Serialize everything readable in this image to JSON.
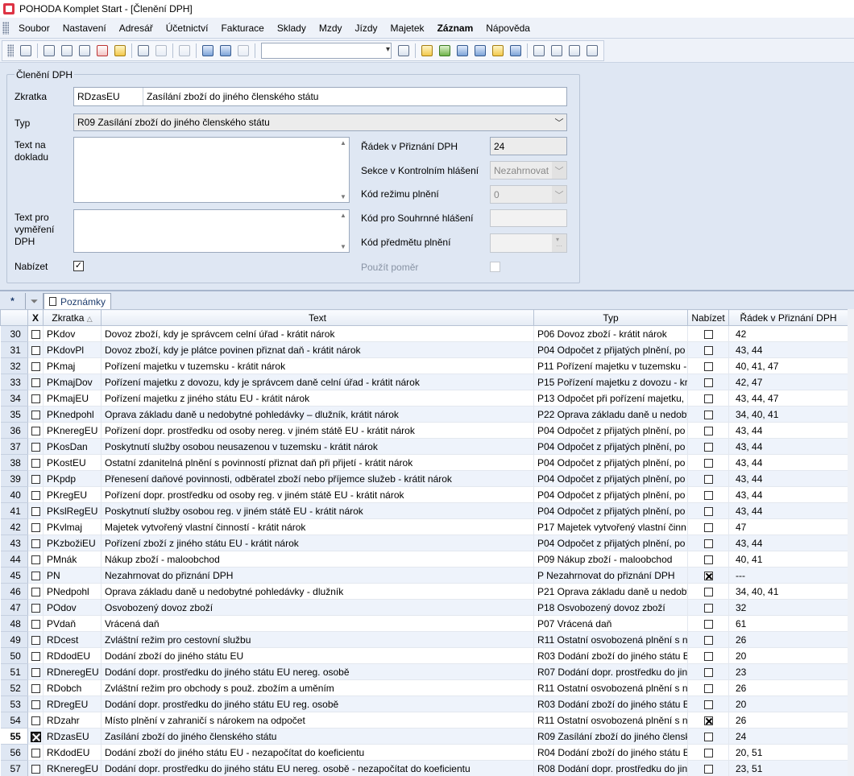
{
  "window": {
    "title": "POHODA Komplet Start - [Členění DPH]"
  },
  "menu": [
    "Soubor",
    "Nastavení",
    "Adresář",
    "Účetnictví",
    "Fakturace",
    "Sklady",
    "Mzdy",
    "Jízdy",
    "Majetek",
    "Záznam",
    "Nápověda"
  ],
  "form": {
    "legend": "Členění DPH",
    "zkratka_label": "Zkratka",
    "zkratka_value": "RDzasEU",
    "nazev_value": "Zasílání zboží do jiného členského státu",
    "typ_label": "Typ",
    "typ_value": "R09 Zasílání zboží do jiného členského státu",
    "text_na_dokladu_label": "Text na dokladu",
    "text_pro_vymereni_label": "Text pro vyměření DPH",
    "nabizet_label": "Nabízet",
    "nabizet_checked": "✓",
    "radek_label": "Řádek v Přiznání DPH",
    "radek_value": "24",
    "sekce_label": "Sekce v Kontrolním hlášení",
    "sekce_value": "Nezahrnovat",
    "kod_rezimu_label": "Kód režimu plnění",
    "kod_rezimu_value": "0",
    "kod_souhrnne_label": "Kód pro Souhrnné hlášení",
    "kod_predmetu_label": "Kód předmětu plnění",
    "pouzit_pomer_label": "Použít poměr"
  },
  "tabs": {
    "star": "*",
    "notes": "Poznámky"
  },
  "grid": {
    "columns": {
      "x": "X",
      "zkratka": "Zkratka",
      "text": "Text",
      "typ": "Typ",
      "nabizet": "Nabízet",
      "radek": "Řádek v Přiznání DPH"
    },
    "rows": [
      {
        "n": "30",
        "z": "PKdov",
        "t": "Dovoz zboží, kdy je správcem celní úřad - krátit nárok",
        "typ": "P06 Dovoz zboží - krátit nárok",
        "nab": false,
        "r": "42",
        "sel": false
      },
      {
        "n": "31",
        "z": "PKdovPl",
        "t": "Dovoz zboží, kdy je plátce povinen přiznat daň - krátit nárok",
        "typ": "P04 Odpočet z přijatých plnění, po",
        "nab": false,
        "r": "43, 44",
        "sel": false
      },
      {
        "n": "32",
        "z": "PKmaj",
        "t": "Pořízení majetku v tuzemsku - krátit nárok",
        "typ": "P11 Pořízení majetku v tuzemsku -",
        "nab": false,
        "r": "40, 41, 47",
        "sel": false
      },
      {
        "n": "33",
        "z": "PKmajDov",
        "t": "Pořízení majetku z dovozu, kdy je správcem daně celní úřad - krátit nárok",
        "typ": "P15 Pořízení majetku z dovozu - kr",
        "nab": false,
        "r": "42, 47",
        "sel": false
      },
      {
        "n": "34",
        "z": "PKmajEU",
        "t": "Pořízení majetku z jiného státu EU - krátit nárok",
        "typ": "P13 Odpočet při pořízení majetku,",
        "nab": false,
        "r": "43, 44, 47",
        "sel": false
      },
      {
        "n": "35",
        "z": "PKnedpohl",
        "t": "Oprava základu daně u nedobytné pohledávky – dlužník, krátit nárok",
        "typ": "P22 Oprava základu daně u nedoby",
        "nab": false,
        "r": "34, 40, 41",
        "sel": false
      },
      {
        "n": "36",
        "z": "PKneregEU",
        "t": "Pořízení dopr. prostředku od osoby nereg. v jiném státě EU - krátit nárok",
        "typ": "P04 Odpočet z přijatých plnění, po",
        "nab": false,
        "r": "43, 44",
        "sel": false
      },
      {
        "n": "37",
        "z": "PKosDan",
        "t": "Poskytnutí služby osobou neusazenou v tuzemsku - krátit nárok",
        "typ": "P04 Odpočet z přijatých plnění, po",
        "nab": false,
        "r": "43, 44",
        "sel": false
      },
      {
        "n": "38",
        "z": "PKostEU",
        "t": "Ostatní zdanitelná plnění s povinností přiznat daň při přijetí - krátit nárok",
        "typ": "P04 Odpočet z přijatých plnění, po",
        "nab": false,
        "r": "43, 44",
        "sel": false
      },
      {
        "n": "39",
        "z": "PKpdp",
        "t": "Přenesení daňové povinnosti, odběratel zboží nebo příjemce služeb - krátit nárok",
        "typ": "P04 Odpočet z přijatých plnění, po",
        "nab": false,
        "r": "43, 44",
        "sel": false
      },
      {
        "n": "40",
        "z": "PKregEU",
        "t": "Pořízení dopr. prostředku od osoby reg. v jiném státě EU - krátit nárok",
        "typ": "P04 Odpočet z přijatých plnění, po",
        "nab": false,
        "r": "43, 44",
        "sel": false
      },
      {
        "n": "41",
        "z": "PKslRegEU",
        "t": "Poskytnutí služby osobou reg. v jiném státě EU - krátit nárok",
        "typ": "P04 Odpočet z přijatých plnění, po",
        "nab": false,
        "r": "43, 44",
        "sel": false
      },
      {
        "n": "42",
        "z": "PKvlmaj",
        "t": "Majetek vytvořený vlastní činností - krátit nárok",
        "typ": "P17 Majetek vytvořený vlastní činn",
        "nab": false,
        "r": "47",
        "sel": false
      },
      {
        "n": "43",
        "z": "PKzbožiEU",
        "t": "Pořízení zboží z jiného státu EU - krátit nárok",
        "typ": "P04 Odpočet z přijatých plnění, po",
        "nab": false,
        "r": "43, 44",
        "sel": false
      },
      {
        "n": "44",
        "z": "PMnák",
        "t": "Nákup zboží - maloobchod",
        "typ": "P09 Nákup zboží - maloobchod",
        "nab": false,
        "r": "40, 41",
        "sel": false
      },
      {
        "n": "45",
        "z": "PN",
        "t": "Nezahrnovat do přiznání DPH",
        "typ": "P Nezahrnovat do přiznání DPH",
        "nab": true,
        "r": "---",
        "sel": false
      },
      {
        "n": "46",
        "z": "PNedpohl",
        "t": "Oprava základu daně u nedobytné pohledávky - dlužník",
        "typ": "P21 Oprava základu daně u nedoby",
        "nab": false,
        "r": "34, 40, 41",
        "sel": false
      },
      {
        "n": "47",
        "z": "POdov",
        "t": "Osvobozený dovoz zboží",
        "typ": "P18 Osvobozený dovoz zboží",
        "nab": false,
        "r": "32",
        "sel": false
      },
      {
        "n": "48",
        "z": "PVdaň",
        "t": "Vrácená daň",
        "typ": "P07 Vrácená daň",
        "nab": false,
        "r": "61",
        "sel": false
      },
      {
        "n": "49",
        "z": "RDcest",
        "t": "Zvláštní režim pro cestovní službu",
        "typ": "R11 Ostatní osvobozená plnění s n",
        "nab": false,
        "r": "26",
        "sel": false
      },
      {
        "n": "50",
        "z": "RDdodEU",
        "t": "Dodání zboží do jiného státu EU",
        "typ": "R03 Dodání zboží do jiného státu E",
        "nab": false,
        "r": "20",
        "sel": false
      },
      {
        "n": "51",
        "z": "RDneregEU",
        "t": "Dodání dopr. prostředku do jiného státu EU nereg. osobě",
        "typ": "R07 Dodání dopr. prostředku do jin",
        "nab": false,
        "r": "23",
        "sel": false
      },
      {
        "n": "52",
        "z": "RDobch",
        "t": "Zvláštní režim pro obchody s použ. zbožím a uměním",
        "typ": "R11 Ostatní osvobozená plnění s n",
        "nab": false,
        "r": "26",
        "sel": false
      },
      {
        "n": "53",
        "z": "RDregEU",
        "t": "Dodání dopr. prostředku do jiného státu EU reg. osobě",
        "typ": "R03 Dodání zboží do jiného státu E",
        "nab": false,
        "r": "20",
        "sel": false
      },
      {
        "n": "54",
        "z": "RDzahr",
        "t": "Místo plnění v zahraničí s nárokem na odpočet",
        "typ": "R11 Ostatní osvobozená plnění s n",
        "nab": true,
        "r": "26",
        "sel": false
      },
      {
        "n": "55",
        "z": "RDzasEU",
        "t": "Zasílání zboží do jiného členského státu",
        "typ": "R09 Zasílání zboží do jiného člensk",
        "nab": false,
        "r": "24",
        "sel": true
      },
      {
        "n": "56",
        "z": "RKdodEU",
        "t": "Dodání zboží do jiného státu EU - nezapočítat do koeficientu",
        "typ": "R04 Dodání zboží do jiného státu E",
        "nab": false,
        "r": "20, 51",
        "sel": false
      },
      {
        "n": "57",
        "z": "RKneregEU",
        "t": "Dodání dopr. prostředku do jiného státu EU nereg. osobě - nezapočítat do koeficientu",
        "typ": "R08 Dodání dopr. prostředku do jin",
        "nab": false,
        "r": "23, 51",
        "sel": false
      }
    ]
  }
}
